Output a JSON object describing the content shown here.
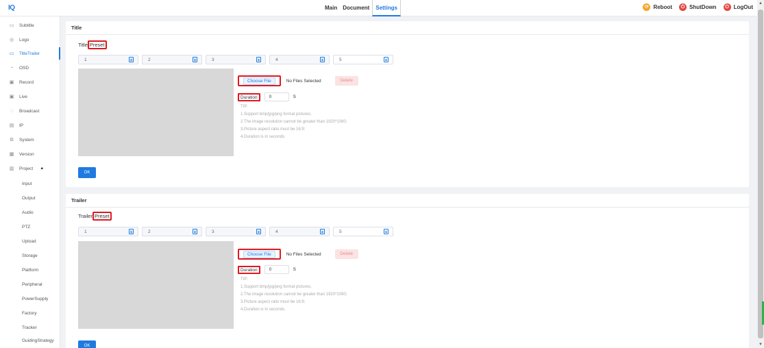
{
  "app": {
    "logo": "IQ"
  },
  "nav": {
    "items": [
      "Main",
      "Document",
      "Settings"
    ],
    "active": "Settings"
  },
  "system": {
    "reboot": "Reboot",
    "shutdown": "ShutDown",
    "logout": "LogOut",
    "colors": {
      "reboot": "#f5a623",
      "shutdown": "#e64545",
      "logout": "#e64545"
    }
  },
  "sidebar": {
    "items": [
      {
        "label": "Subtitle",
        "icon": "subtitle-icon"
      },
      {
        "label": "Logo",
        "icon": "logo-icon"
      },
      {
        "label": "TitleTrailer",
        "icon": "title-trailer-icon",
        "active": true
      },
      {
        "label": "OSD",
        "icon": "osd-icon"
      },
      {
        "label": "Record",
        "icon": "record-icon"
      },
      {
        "label": "Live",
        "icon": "live-icon"
      },
      {
        "label": "Broadcast",
        "icon": "broadcast-icon"
      },
      {
        "label": "IP",
        "icon": "ip-icon"
      },
      {
        "label": "System",
        "icon": "system-icon"
      },
      {
        "label": "Version",
        "icon": "version-icon"
      },
      {
        "label": "Project",
        "icon": "project-icon",
        "expanded": true
      }
    ],
    "sub_items": [
      "Input",
      "Output",
      "Audio",
      "PTZ",
      "Upload",
      "Storage",
      "Platform",
      "Peripheral",
      "PowerSupply",
      "Factory",
      "Tracker",
      "GuidingStrategy"
    ]
  },
  "title_panel": {
    "header": "Title",
    "preset_prefix": "Title",
    "preset_label": "Preset",
    "slots": [
      "1",
      "2",
      "3",
      "4",
      "5"
    ],
    "choose_file": "Choose File",
    "no_file": "No Files Selected",
    "delete": "Delete",
    "duration_label": "Duration",
    "duration_value": "0",
    "duration_unit": "S",
    "tip_title": "TIP:",
    "tips": [
      "1.Support bmp/jpg/png format pictures;",
      "2.The image resolution cannot be greater than 1920*1080;",
      "3.Picture aspect ratio must be 16:9;",
      "4.Duration is in seconds."
    ],
    "ok": "OK"
  },
  "trailer_panel": {
    "header": "Trailer",
    "preset_prefix": "Trailer",
    "preset_label": "Preset",
    "slots": [
      "1",
      "2",
      "3",
      "4",
      "5"
    ],
    "choose_file": "Choose File",
    "no_file": "No Files Selected",
    "delete": "Delete",
    "duration_label": "Duration",
    "duration_value": "0",
    "duration_unit": "S",
    "tip_title": "TIP:",
    "tips": [
      "1.Support bmp/jpg/png format pictures;",
      "2.The image resolution cannot be greater than 1920*1080;",
      "3.Picture aspect ratio must be 16:9;",
      "4.Duration is in seconds."
    ],
    "ok": "OK"
  },
  "colors": {
    "accent": "#1f7ae0",
    "highlight": "#e1171e"
  }
}
